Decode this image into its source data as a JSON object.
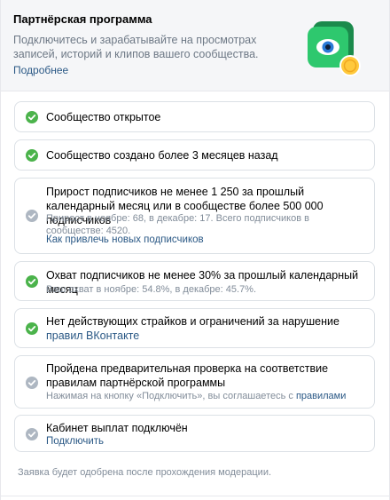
{
  "header": {
    "title": "Партнёрская программа",
    "description": "Подключитесь и зарабатывайте на просмотрах записей, историй и клипов вашего сообщества.",
    "more_link": "Подробнее"
  },
  "colors": {
    "ok": "#4bb34b",
    "pending": "#aeb7c2",
    "link": "#2a5885",
    "promo_green": "#2ec86e",
    "promo_coin": "#ffc93c"
  },
  "requirements": [
    {
      "status": "done",
      "title": "Сообщество открытое"
    },
    {
      "status": "done",
      "title": "Сообщество создано более 3 месяцев назад"
    },
    {
      "status": "pending",
      "title": "Прирост подписчиков не менее 1 250 за прошлый календарный месяц или в сообществе более 500 000 подписчиков",
      "subtitle": "Прирост в ноябре: 68, в декабре: 17. Всего подписчиков в сообществе: 4520.",
      "link": "Как привлечь новых подписчиков"
    },
    {
      "status": "done",
      "title": "Охват подписчиков не менее 30% за прошлый календарный месяц",
      "subtitle": "Ваш охват в ноябре: 54.8%, в декабре: 45.7%."
    },
    {
      "status": "done",
      "title_prefix": "Нет действующих страйков и ограничений за нарушение ",
      "title_link": "правил ВКонтакте"
    },
    {
      "status": "pending",
      "title": "Пройдена предварительная проверка на соответствие правилам партнёрской программы",
      "subtitle_prefix": "Нажимая на кнопку «Подключить», вы соглашаетесь с ",
      "subtitle_link": "правилами"
    },
    {
      "status": "pending",
      "title": "Кабинет выплат подключён",
      "link": "Подключить"
    }
  ],
  "footer_note": "Заявка будет одобрена после прохождения модерации."
}
